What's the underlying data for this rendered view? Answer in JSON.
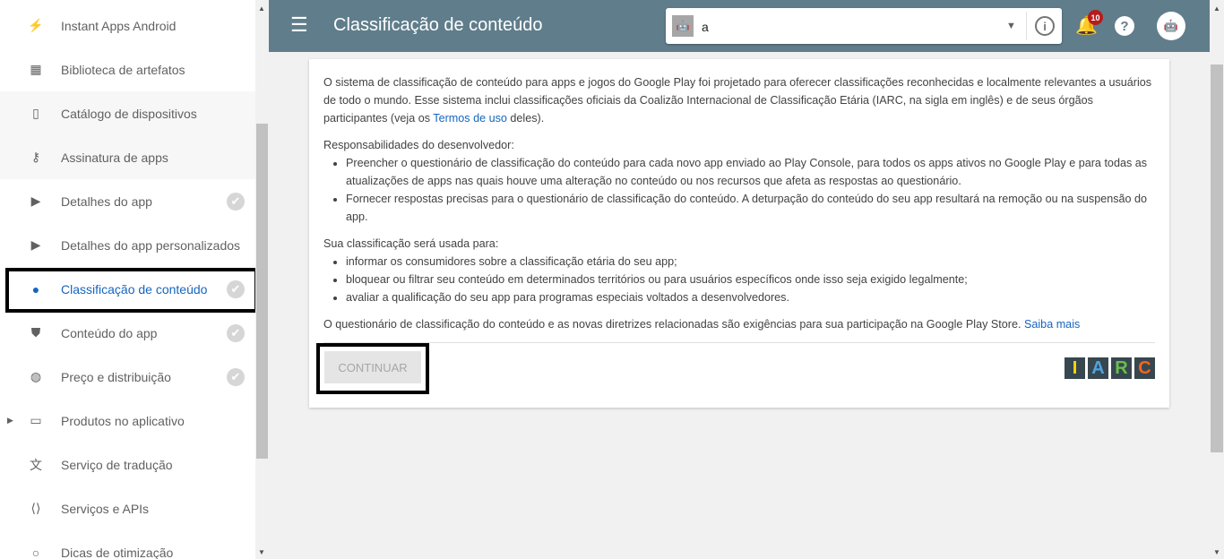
{
  "sidebar": {
    "items": [
      {
        "label": "Instant Apps Android",
        "icon": "flash-icon",
        "icon_glyph": "⚡",
        "checked": false
      },
      {
        "label": "Biblioteca de artefatos",
        "icon": "library-icon",
        "icon_glyph": "▦",
        "checked": false
      },
      {
        "label": "Catálogo de dispositivos",
        "icon": "device-check-icon",
        "icon_glyph": "▯",
        "checked": false
      },
      {
        "label": "Assinatura de apps",
        "icon": "key-icon",
        "icon_glyph": "⚷",
        "checked": false
      },
      {
        "label": "Detalhes do app",
        "icon": "store-icon",
        "icon_glyph": "▶",
        "checked": true
      },
      {
        "label": "Detalhes do app personalizados",
        "icon": "store-icon",
        "icon_glyph": "▶",
        "checked": false
      },
      {
        "label": "Classificação de conteúdo",
        "icon": "content-rating-icon",
        "icon_glyph": "●",
        "checked": true,
        "active": true
      },
      {
        "label": "Conteúdo do app",
        "icon": "shield-icon",
        "icon_glyph": "⛊",
        "checked": true
      },
      {
        "label": "Preço e distribuição",
        "icon": "globe-icon",
        "icon_glyph": "◍",
        "checked": true
      },
      {
        "label": "Produtos no aplicativo",
        "icon": "credit-card-icon",
        "icon_glyph": "▭",
        "checked": false,
        "expandable": true
      },
      {
        "label": "Serviço de tradução",
        "icon": "translate-icon",
        "icon_glyph": "文",
        "checked": false
      },
      {
        "label": "Serviços e APIs",
        "icon": "api-icon",
        "icon_glyph": "⟨⟩",
        "checked": false
      },
      {
        "label": "Dicas de otimização",
        "icon": "lightbulb-icon",
        "icon_glyph": "○",
        "checked": false
      }
    ]
  },
  "header": {
    "title": "Classificação de conteúdo",
    "app_value": "a",
    "notification_count": "10",
    "bg": "#607d8b"
  },
  "card": {
    "intro_1": "O sistema de classificação de conteúdo para apps e jogos do Google Play foi projetado para oferecer classificações reconhecidas e localmente relevantes a usuários de todo o mundo. Esse sistema inclui classificações oficiais da Coalizão Internacional de Classificação Etária (IARC, na sigla em inglês) e de seus órgãos participantes (veja os ",
    "terms_link": "Termos de uso",
    "intro_2": " deles).",
    "resp_title": "Responsabilidades do desenvolvedor:",
    "resp": [
      "Preencher o questionário de classificação do conteúdo para cada novo app enviado ao Play Console, para todos os apps ativos no Google Play e para todas as atualizações de apps nas quais houve uma alteração no conteúdo ou nos recursos que afeta as respostas ao questionário.",
      "Fornecer respostas precisas para o questionário de classificação do conteúdo. A deturpação do conteúdo do seu app resultará na remoção ou na suspensão do app."
    ],
    "use_title": "Sua classificação será usada para:",
    "use": [
      "informar os consumidores sobre a classificação etária do seu app;",
      "bloquear ou filtrar seu conteúdo em determinados territórios ou para usuários específicos onde isso seja exigido legalmente;",
      "avaliar a qualificação do seu app para programas especiais voltados a desenvolvedores."
    ],
    "footer_text": "O questionário de classificação do conteúdo e as novas diretrizes relacionadas são exigências para sua participação na Google Play Store. ",
    "learn_more": "Saiba mais",
    "continue_label": "CONTINUAR",
    "iarc_letters": [
      {
        "l": "I",
        "c": "#ffd600"
      },
      {
        "l": "A",
        "c": "#4fa3e0"
      },
      {
        "l": "R",
        "c": "#6abf4b"
      },
      {
        "l": "C",
        "c": "#f26522"
      }
    ]
  }
}
